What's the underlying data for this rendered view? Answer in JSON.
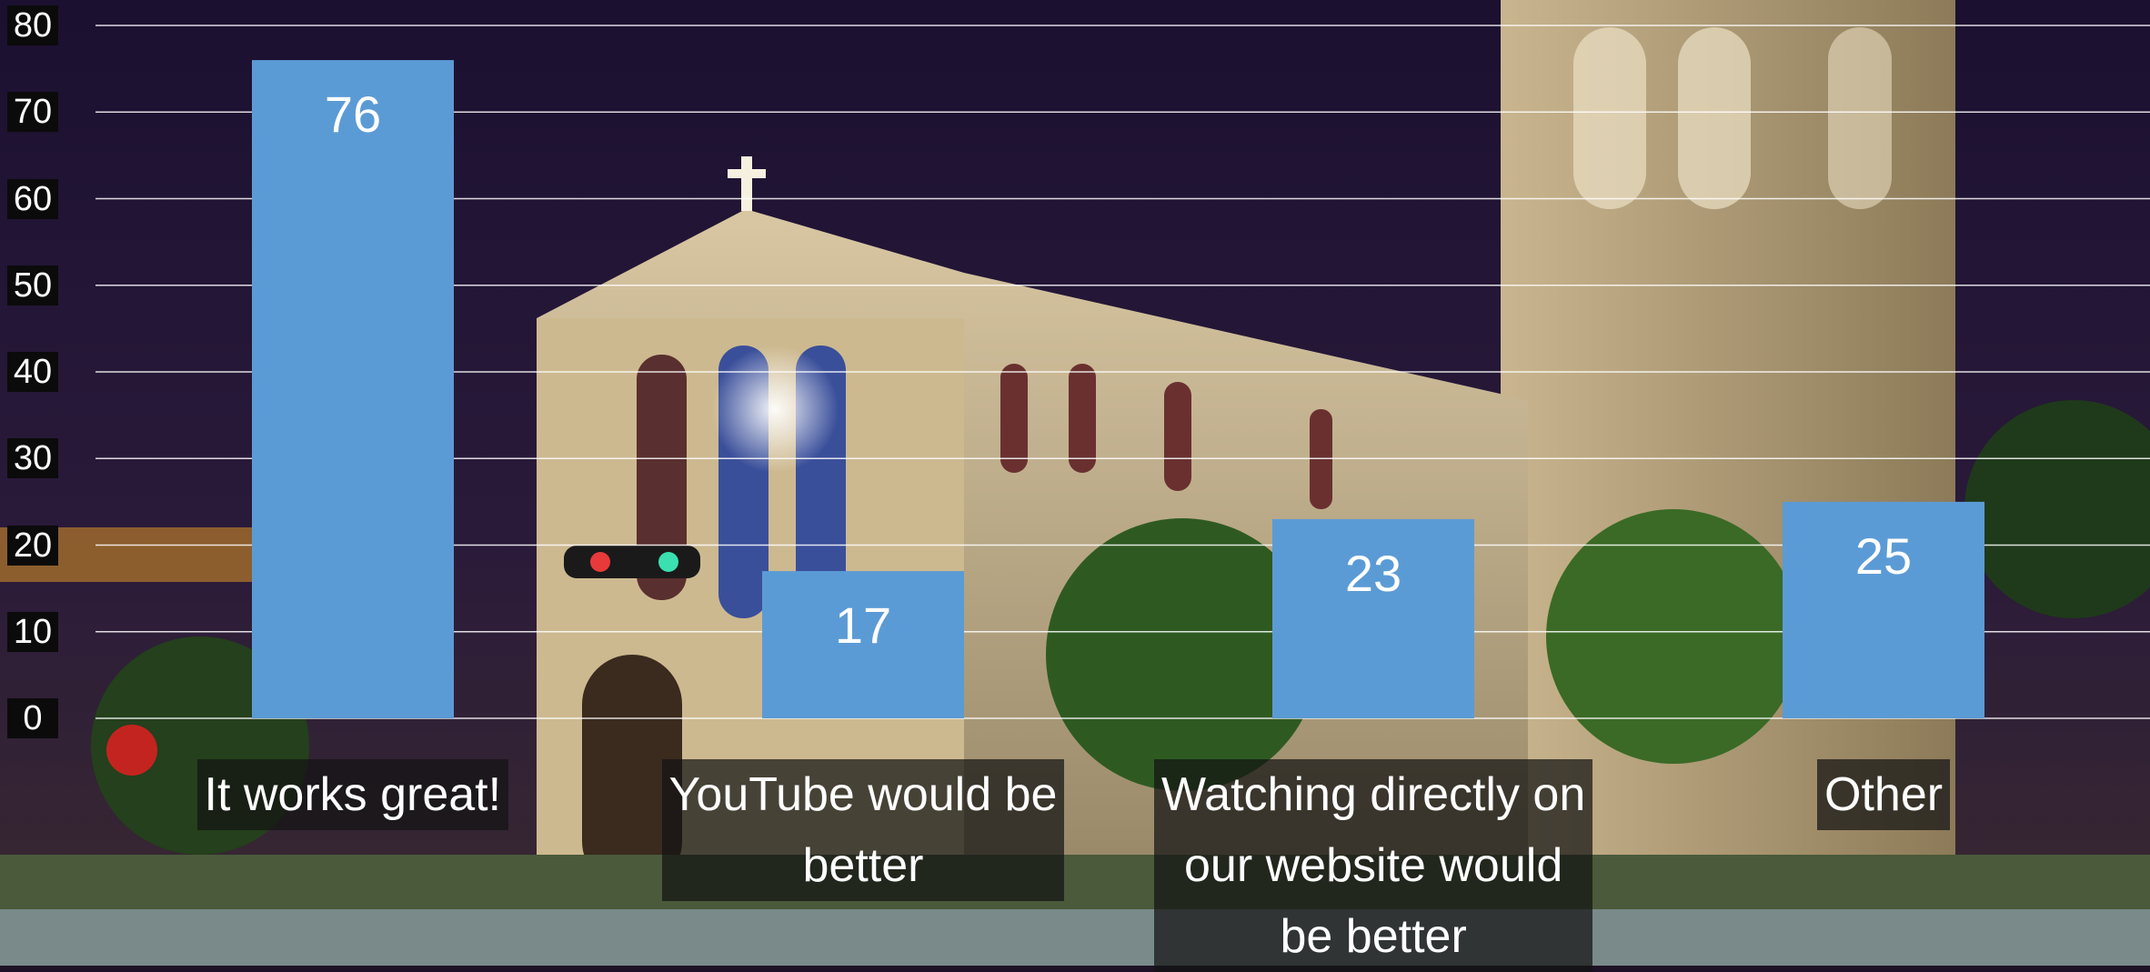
{
  "colors": {
    "bar": "#5b9bd5",
    "gridline": "#ffffff",
    "text": "#ffffff",
    "tick_background": "#0b0b0b",
    "label_background": "#141414"
  },
  "background": {
    "icon": "church-night-photo-background"
  },
  "chart_data": {
    "type": "bar",
    "title": "",
    "xlabel": "",
    "ylabel": "",
    "ylim": [
      0,
      80
    ],
    "yticks": [
      "0",
      "10",
      "20",
      "30",
      "40",
      "50",
      "60",
      "70",
      "80"
    ],
    "grid": true,
    "legend": "none",
    "categories": [
      "It works great!",
      "YouTube would be better",
      "Watching directly on our website would be better",
      "Other"
    ],
    "category_display_lines": [
      [
        "It works great!"
      ],
      [
        "YouTube would be",
        "better"
      ],
      [
        "Watching directly on",
        "our website would",
        "be better"
      ],
      [
        "Other"
      ]
    ],
    "values": [
      76,
      17,
      23,
      25
    ],
    "data_labels": [
      "76",
      "17",
      "23",
      "25"
    ]
  }
}
